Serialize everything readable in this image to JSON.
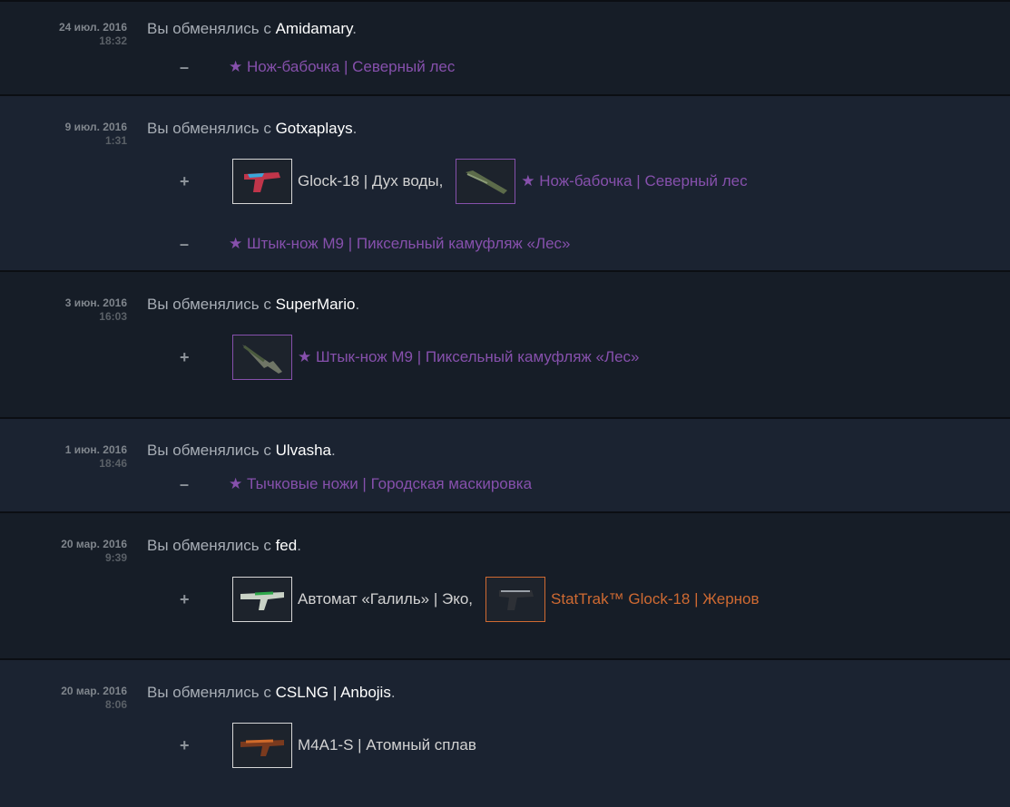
{
  "prefix": "Вы обменялись с",
  "trades": [
    {
      "date": "24 июл. 2016",
      "time": "18:32",
      "partner": "Amidamary",
      "lines": [
        {
          "sign": "–",
          "items": [
            {
              "name": "★ Нож-бабочка | Северный лес",
              "rarity": "covert",
              "icon": null
            }
          ]
        }
      ]
    },
    {
      "date": "9 июл. 2016",
      "time": "1:31",
      "partner": "Gotxaplays",
      "lines": [
        {
          "sign": "+",
          "items": [
            {
              "name": "Glock-18 | Дух воды",
              "rarity": "normal",
              "icon": "glock-water-icon",
              "comma": true
            },
            {
              "name": "★ Нож-бабочка | Северный лес",
              "rarity": "covert",
              "icon": "butterfly-knife-icon"
            }
          ]
        },
        {
          "sign": "–",
          "items": [
            {
              "name": "★ Штык-нож M9 | Пиксельный камуфляж «Лес»",
              "rarity": "covert",
              "icon": null
            }
          ]
        }
      ]
    },
    {
      "date": "3 июн. 2016",
      "time": "16:03",
      "partner": "SuperMario",
      "lines": [
        {
          "sign": "+",
          "items": [
            {
              "name": "★ Штык-нож M9 | Пиксельный камуфляж «Лес»",
              "rarity": "covert",
              "icon": "m9-bayonet-icon"
            }
          ]
        }
      ]
    },
    {
      "date": "1 июн. 2016",
      "time": "18:46",
      "partner": "Ulvasha",
      "lines": [
        {
          "sign": "–",
          "items": [
            {
              "name": "★ Тычковые ножи | Городская маскировка",
              "rarity": "covert",
              "icon": null
            }
          ]
        }
      ]
    },
    {
      "date": "20 мар. 2016",
      "time": "9:39",
      "partner": "fed",
      "lines": [
        {
          "sign": "+",
          "items": [
            {
              "name": "Автомат «Галиль» | Эко",
              "rarity": "normal",
              "icon": "galil-eco-icon",
              "comma": true
            },
            {
              "name": "StatTrak™ Glock-18 | Жернов",
              "rarity": "strange",
              "icon": "glock-grinder-icon"
            }
          ]
        }
      ]
    },
    {
      "date": "20 мар. 2016",
      "time": "8:06",
      "partner": "CSLNG | Anbojis",
      "lines": [
        {
          "sign": "+",
          "items": [
            {
              "name": "M4A1-S | Атомный сплав",
              "rarity": "normal",
              "icon": "m4a1s-atomic-icon"
            }
          ]
        }
      ]
    }
  ],
  "colors": {
    "covert": "#8650ac",
    "strange": "#cf6a32",
    "partner": "#ffffff"
  }
}
